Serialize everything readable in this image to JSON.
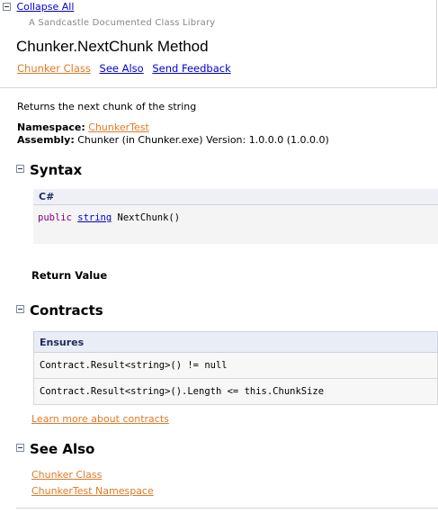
{
  "header": {
    "collapse_all": "Collapse All",
    "library_name": "A Sandcastle Documented Class Library",
    "title": "Chunker.NextChunk Method",
    "links": [
      "Chunker Class",
      "See Also",
      "Send Feedback"
    ]
  },
  "summary": "Returns the next chunk of the string",
  "namespace": {
    "label": "Namespace:",
    "value": "ChunkerTest"
  },
  "assembly": {
    "label": "Assembly:",
    "value": "Chunker (in Chunker.exe) Version: 1.0.0.0 (1.0.0.0)"
  },
  "syntax": {
    "heading": "Syntax",
    "language": "C#",
    "code": {
      "keyword": "public",
      "type": "string",
      "rest": "NextChunk()"
    },
    "return_value_label": "Return Value"
  },
  "contracts": {
    "heading": "Contracts",
    "ensures_label": "Ensures",
    "rows": [
      "Contract.Result<string>() != null",
      "Contract.Result<string>().Length <= this.ChunkSize"
    ],
    "learn_more": "Learn more about contracts"
  },
  "see_also": {
    "heading": "See Also",
    "links": [
      "Chunker Class",
      "ChunkerTest Namespace"
    ]
  }
}
